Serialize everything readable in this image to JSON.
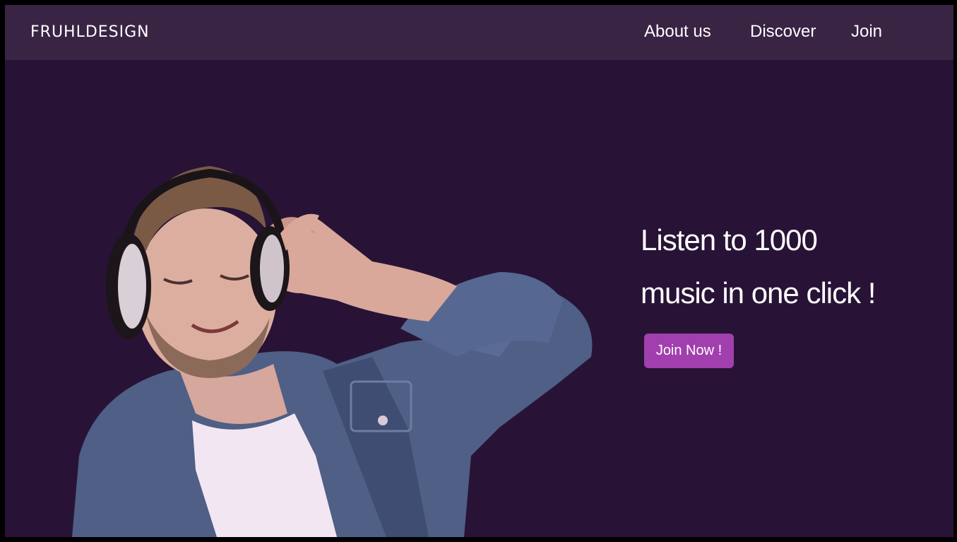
{
  "header": {
    "brand": "FRUHLDESIGN",
    "nav": [
      {
        "label": "About us"
      },
      {
        "label": "Discover"
      },
      {
        "label": "Join"
      }
    ]
  },
  "hero": {
    "title_line1": "Listen to 1000",
    "title_line2": "music in one click !",
    "cta_label": "Join Now !"
  },
  "colors": {
    "page_background": "#281336",
    "navbar_background": "#392444",
    "cta_background": "#a23fae",
    "text": "#ffffff"
  }
}
